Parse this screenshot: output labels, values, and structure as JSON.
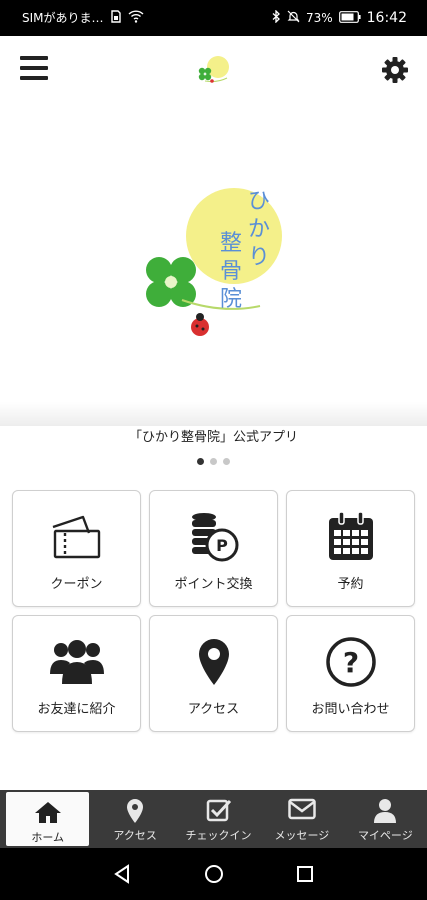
{
  "status_bar": {
    "carrier": "SIMがありま…",
    "battery": "73%",
    "time": "16:42"
  },
  "hero": {
    "logo_text": "ひかり整骨院"
  },
  "caption": "「ひかり整骨院」公式アプリ",
  "tiles": [
    {
      "label": "クーポン",
      "icon": "ticket-icon"
    },
    {
      "label": "ポイント交換",
      "icon": "coins-point-icon"
    },
    {
      "label": "予約",
      "icon": "calendar-icon"
    },
    {
      "label": "お友達に紹介",
      "icon": "group-users-icon"
    },
    {
      "label": "アクセス",
      "icon": "map-pin-icon"
    },
    {
      "label": "お問い合わせ",
      "icon": "question-icon"
    }
  ],
  "bottom_nav": [
    {
      "label": "ホーム",
      "icon": "home-icon"
    },
    {
      "label": "アクセス",
      "icon": "map-pin-icon"
    },
    {
      "label": "チェックイン",
      "icon": "checkin-icon"
    },
    {
      "label": "メッセージ",
      "icon": "envelope-icon"
    },
    {
      "label": "マイページ",
      "icon": "user-icon"
    }
  ],
  "colors": {
    "nav_bg": "#3a3a3a",
    "logo_yellow": "#f4f08a",
    "logo_green": "#3fae3a",
    "logo_blue": "#5a8fd6"
  }
}
